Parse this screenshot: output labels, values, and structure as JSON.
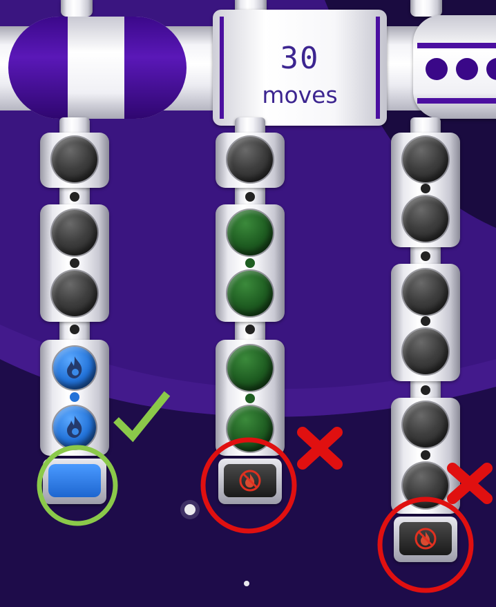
{
  "hud": {
    "moves_count": "30",
    "moves_label": "moves"
  },
  "colors": {
    "background": "#2a0f5c",
    "pipe_purple": "#4b0fa0",
    "ok_circle": "#8bc94a",
    "fail_circle": "#e01010",
    "check_mark": "#8bc94a",
    "cross_mark": "#e01010"
  },
  "columns": [
    {
      "balls_top_to_bottom": [
        "gray",
        "gray",
        "gray",
        "blue-fire",
        "blue-fire"
      ],
      "base_icon": "blue-block",
      "result": "check-mark-icon"
    },
    {
      "balls_top_to_bottom": [
        "gray",
        "green",
        "green",
        "green",
        "green"
      ],
      "base_icon": "no-fire-icon",
      "result": "cross-mark-icon"
    },
    {
      "balls_top_to_bottom": [
        "gray",
        "gray",
        "gray",
        "gray",
        "gray",
        "gray"
      ],
      "base_icon": "no-fire-icon",
      "result": "cross-mark-icon"
    }
  ]
}
